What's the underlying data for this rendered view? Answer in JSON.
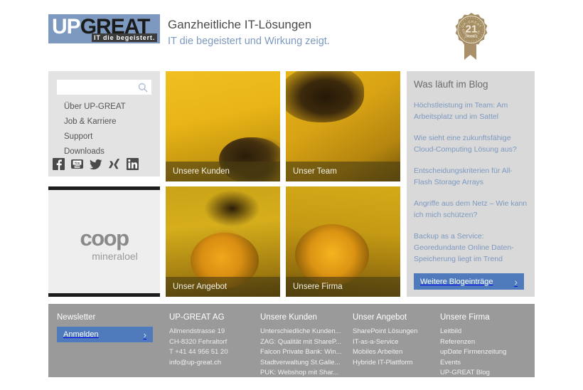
{
  "header": {
    "logo": {
      "up": "UP",
      "great": "GREAT",
      "tagline": "IT die begeistert."
    },
    "headline_1": "Ganzheitliche IT-Lösungen",
    "headline_2": "IT die begeistert und Wirkung zeigt.",
    "badge": {
      "top_text": "UP-GREAT",
      "number": "21",
      "unit": "JAHRE",
      "bottom_text": "GEGRÜNDET 1996"
    }
  },
  "sidebar": {
    "search": {
      "value": "",
      "placeholder": "",
      "icon": "search-icon"
    },
    "nav": [
      {
        "label": "Über UP-GREAT"
      },
      {
        "label": "Job & Karriere"
      },
      {
        "label": "Support"
      },
      {
        "label": "Downloads"
      }
    ],
    "social": [
      {
        "name": "facebook-icon"
      },
      {
        "name": "youtube-icon"
      },
      {
        "name": "twitter-icon"
      },
      {
        "name": "xing-icon"
      },
      {
        "name": "linkedin-icon"
      }
    ]
  },
  "partner_panel": {
    "brand": "coop",
    "sub": "mineraloel"
  },
  "tiles": [
    {
      "caption": "Unsere Kunden"
    },
    {
      "caption": "Unser Team"
    },
    {
      "caption": "Unser Angebot"
    },
    {
      "caption": "Unsere Firma"
    }
  ],
  "blog": {
    "title": "Was läuft im Blog",
    "entries": [
      {
        "label": "Höchstleistung im Team: Am Arbeitsplatz und im Sattel"
      },
      {
        "label": "Wie sieht eine zukunftsfähige Cloud-Computing Lösung aus?"
      },
      {
        "label": "Entscheidungskriterien für All-Flash Storage Arrays"
      },
      {
        "label": "Angriffe aus dem Netz – Wie kann ich mich schützen?"
      },
      {
        "label": "Backup as a Service: Georedundante Online Daten-Speicherung liegt im Trend"
      }
    ],
    "button": {
      "label": "Weitere Blogeinträge",
      "arrow": "›"
    }
  },
  "footer": {
    "newsletter": {
      "heading": "Newsletter",
      "button": {
        "label": "Anmelden",
        "arrow": "›"
      }
    },
    "company": {
      "heading": "UP-GREAT AG",
      "lines": [
        "Allmendstrasse 19",
        "CH-8320 Fehraltorf",
        "T +41 44 956 51 20",
        "info@up-great.ch"
      ]
    },
    "kunden": {
      "heading": "Unsere Kunden",
      "links": [
        "Unterschiedliche Kunden...",
        "ZAG: Qualität mit ShareP...",
        "Falcon Private Bank: Win...",
        "Stadtverwaltung St.Galle...",
        "PUK: Webshop mit Shar..."
      ]
    },
    "angebot": {
      "heading": "Unser Angebot",
      "links": [
        "SharePoint Lösungen",
        "IT-as-a-Service",
        "Mobiles Arbeiten",
        "Hybride IT-Plattform"
      ]
    },
    "firma": {
      "heading": "Unsere Firma",
      "links": [
        "Leitbild",
        "Referenzen",
        "upDate Firmenzeitung",
        "Events",
        "UP-GREAT Blog"
      ]
    }
  },
  "colors": {
    "brand_blue": "#7d99c0",
    "button_blue": "#4f7bbd",
    "footer_gray": "#9a9a9a",
    "blog_gray": "#d9d9d9",
    "sidebar_gray": "#e3e3e3",
    "badge_gold": "#a58e63"
  }
}
